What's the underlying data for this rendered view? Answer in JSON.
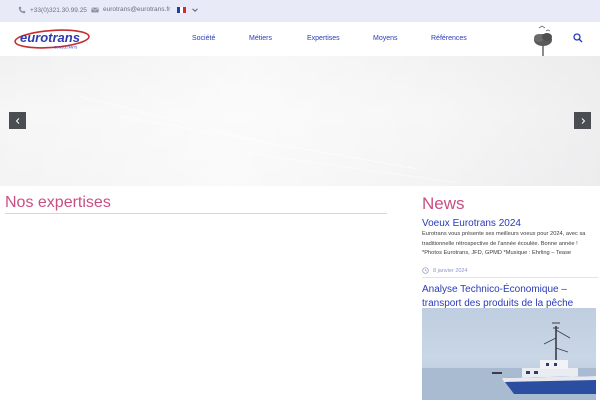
{
  "topbar": {
    "phone": "+33(0)321.30.99.25",
    "email": "eurotrans@eurotrans.fr"
  },
  "header": {
    "logo_text": "eurotrans",
    "logo_subtext": "CONSULTANTS",
    "nav": [
      "Société",
      "Métiers",
      "Expertises",
      "Moyens",
      "Références"
    ]
  },
  "colors": {
    "accent": "#c94e83",
    "link": "#2a3ab8",
    "topbar_bg": "#e9eaf7"
  },
  "main": {
    "expertises_title": "Nos expertises"
  },
  "news": {
    "title": "News",
    "items": [
      {
        "title": "Voeux Eurotrans 2024",
        "body_lines": [
          "Eurotrans vous présente ses meilleurs voeux pour 2024, avec sa",
          "traditionnelle rétrospective de l'année écoulée. Bonne année !",
          "*Photos Eurotrans, JFD, GPMD *Musique : Ehrling – Tease"
        ],
        "date": "8 janvier 2024"
      },
      {
        "title_lines": [
          "Analyse Technico-Économique –",
          "transport des produits de la pêche"
        ]
      }
    ]
  },
  "icons": {
    "phone": "phone-icon",
    "email": "envelope-icon",
    "flag": "french-flag-icon",
    "chevron": "chevron-down-icon",
    "search": "search-icon",
    "prev": "chevron-left-icon",
    "next": "chevron-right-icon",
    "clock": "clock-icon"
  }
}
